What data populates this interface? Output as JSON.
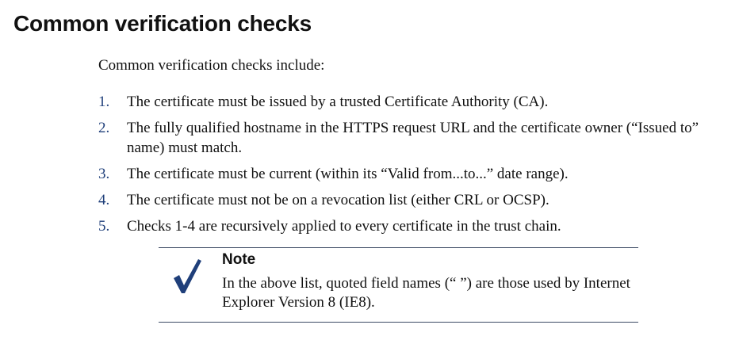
{
  "section": {
    "title": "Common verification checks",
    "intro": "Common verification checks include:"
  },
  "checks": [
    {
      "number": "1.",
      "text": "The certificate must be issued by a trusted Certificate Authority (CA)."
    },
    {
      "number": "2.",
      "text": "The fully qualified hostname in the HTTPS request URL and the certificate owner (“Issued to” name) must match."
    },
    {
      "number": "3.",
      "text": "The certificate must be current (within its “Valid from...to...” date range)."
    },
    {
      "number": "4.",
      "text": "The certificate must not be on a revocation list (either CRL or OCSP)."
    },
    {
      "number": "5.",
      "text": "Checks 1-4 are recursively applied to every certificate in the trust chain."
    }
  ],
  "note": {
    "icon": "checkmark-icon",
    "title": "Note",
    "body": "In the above list, quoted field names (“ ”) are those used by Internet Explorer Version 8 (IE8)."
  },
  "colors": {
    "accent": "#1f3f7a",
    "text": "#111111",
    "rule": "#3d4a64"
  }
}
